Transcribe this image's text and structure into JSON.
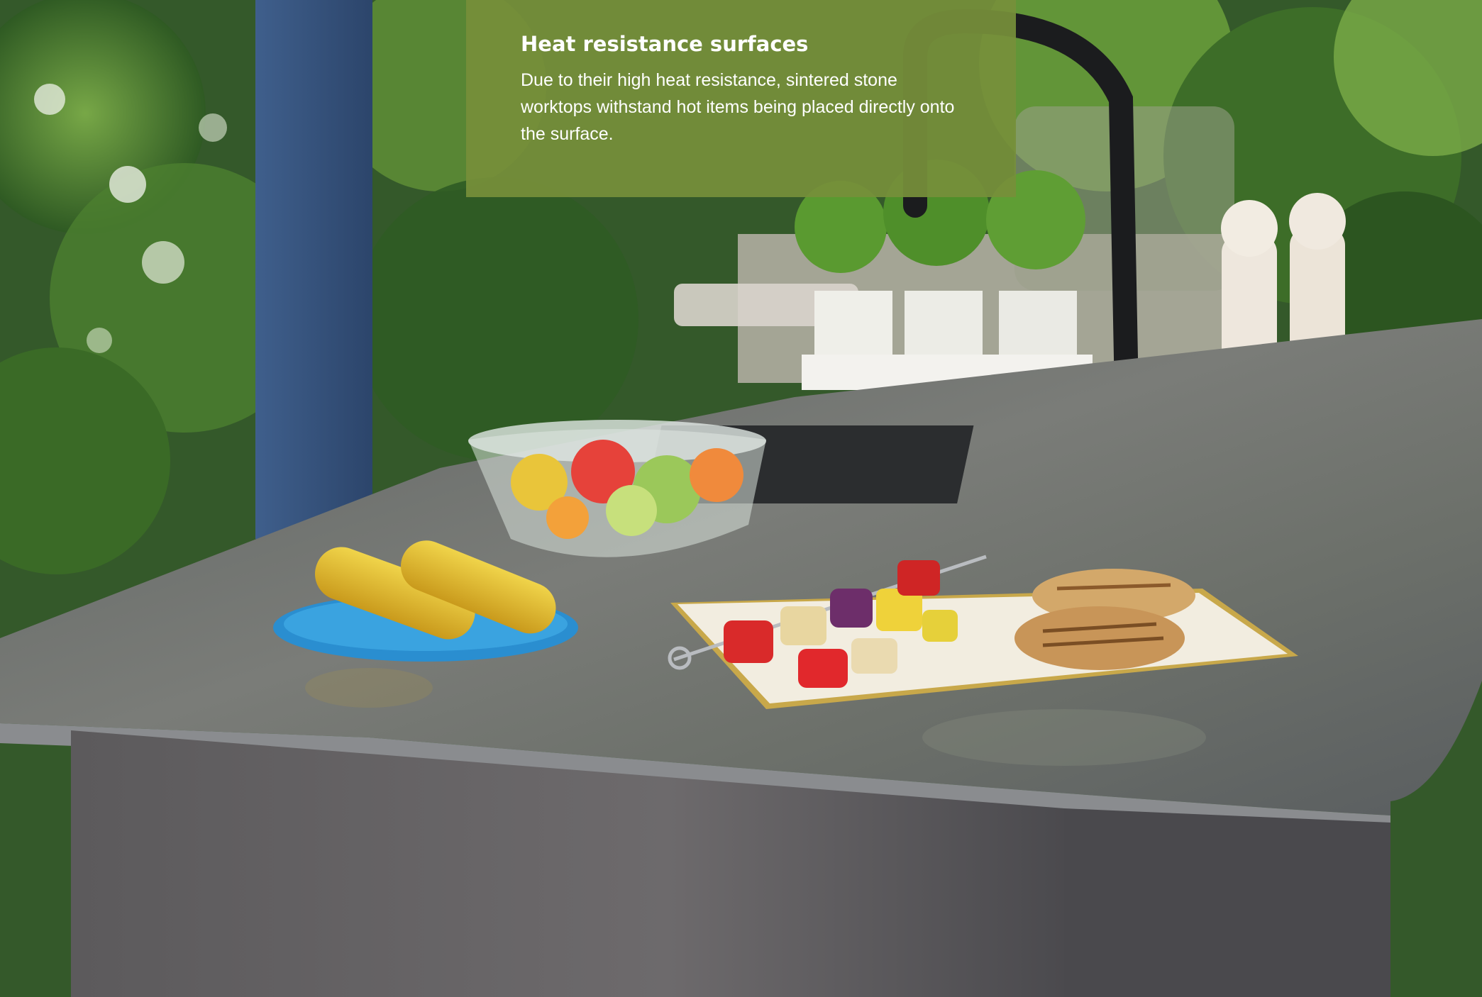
{
  "caption": {
    "title": "Heat resistance surfaces",
    "body": "Due to their high heat resistance, sintered stone worktops withstand hot items being placed directly onto the surface."
  },
  "colors": {
    "caption_bg": "#768f3a",
    "caption_text": "#ffffff",
    "worktop": "#6b6d6c",
    "foliage": "#3f6a2a"
  },
  "photo": {
    "subject_icons": [
      "corn-on-the-cob-icon",
      "salad-bowl-icon",
      "vegetable-skewer-icon",
      "grilled-chicken-icon",
      "black-tap-icon",
      "herb-pots-icon",
      "salt-pepper-mill-icon"
    ]
  }
}
